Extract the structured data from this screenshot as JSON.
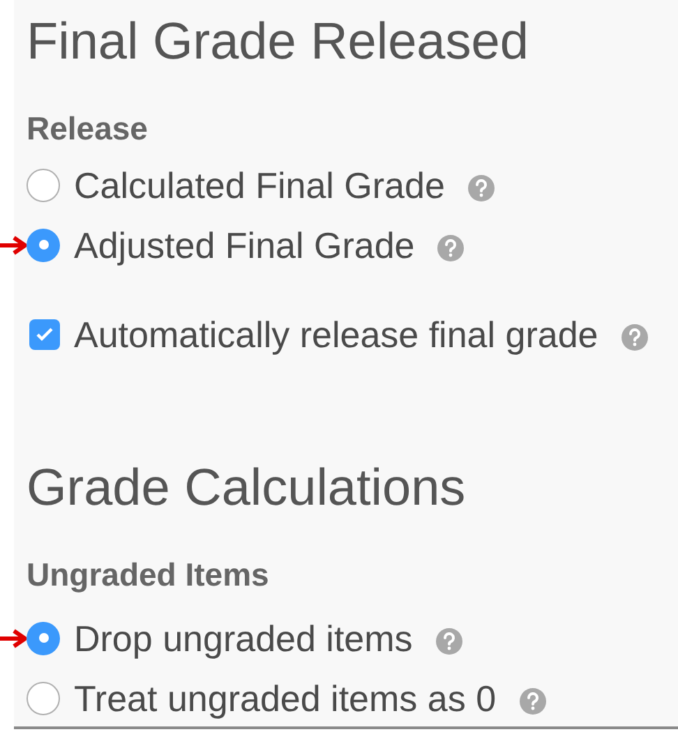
{
  "sections": [
    {
      "title": "Final Grade Released",
      "groups": [
        {
          "label": "Release",
          "items": [
            {
              "kind": "radio",
              "label": "Calculated Final Grade",
              "selected": false,
              "arrow": false
            },
            {
              "kind": "radio",
              "label": "Adjusted Final Grade",
              "selected": true,
              "arrow": true
            },
            {
              "kind": "checkbox",
              "label": "Automatically release final grade",
              "checked": true,
              "arrow": false
            }
          ]
        }
      ]
    },
    {
      "title": "Grade Calculations",
      "groups": [
        {
          "label": "Ungraded Items",
          "items": [
            {
              "kind": "radio",
              "label": "Drop ungraded items",
              "selected": true,
              "arrow": true
            },
            {
              "kind": "radio",
              "label": "Treat ungraded items as 0",
              "selected": false,
              "arrow": false
            }
          ]
        }
      ]
    }
  ]
}
